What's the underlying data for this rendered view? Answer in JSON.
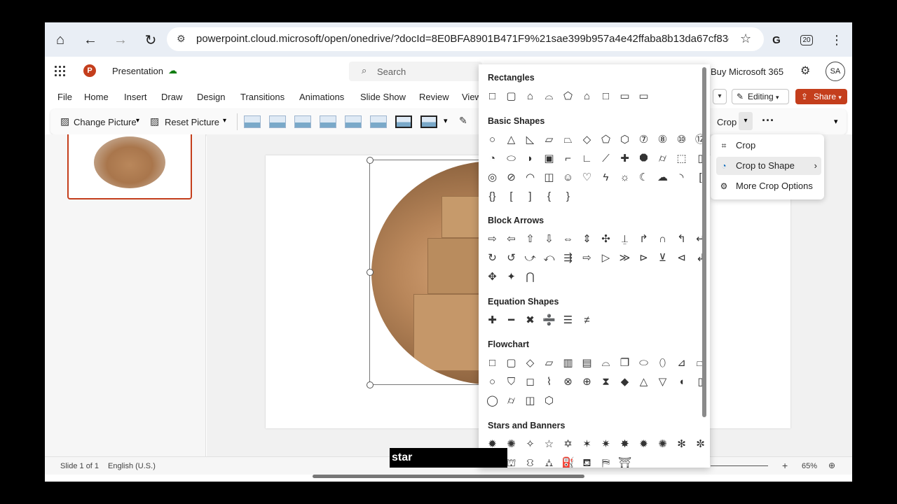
{
  "browser": {
    "url": "powerpoint.cloud.microsoft/open/onedrive/?docId=8E0BFA8901B471F9%21sae399b957a4e42ffaba8b13da67cf83d&c",
    "extension_count": "20"
  },
  "header": {
    "app_title": "Presentation",
    "search_placeholder": "Search",
    "buy_label": "Buy Microsoft 365",
    "avatar_initials": "SA"
  },
  "menu": {
    "items": [
      "File",
      "Home",
      "Insert",
      "Draw",
      "Design",
      "Transitions",
      "Animations",
      "Slide Show",
      "Review",
      "View"
    ],
    "editing_label": "Editing",
    "share_label": "Share"
  },
  "ribbon": {
    "change_picture": "Change Picture",
    "reset_picture": "Reset Picture",
    "crop_label": "Crop",
    "more_label": "···"
  },
  "crop_menu": {
    "items": [
      {
        "label": "Crop",
        "icon": "crop-icon"
      },
      {
        "label": "Crop to Shape",
        "icon": "shape-icon"
      },
      {
        "label": "More Crop Options",
        "icon": "gear-icon"
      }
    ]
  },
  "gallery": {
    "sections": [
      {
        "title": "Rectangles",
        "rows": [
          [
            "□",
            "▢",
            "⌂",
            "⌓",
            "⬠",
            "⌂",
            "□",
            "▭",
            "▭"
          ]
        ]
      },
      {
        "title": "Basic Shapes",
        "rows": [
          [
            "○",
            "△",
            "◺",
            "▱",
            "⏢",
            "◇",
            "⬠",
            "⬡",
            "⑦",
            "⑧",
            "⑩",
            "⑫"
          ],
          [
            "◔",
            "⬭",
            "◗",
            "▣",
            "⌐",
            "∟",
            "⟋",
            "✚",
            "⯃",
            "⌭",
            "⬚",
            "▯"
          ],
          [
            "◎",
            "⊘",
            "◠",
            "◫",
            "☺",
            "♡",
            "ϟ",
            "☼",
            "☾",
            "☁",
            "◝",
            "["
          ],
          [
            "{}",
            "[",
            "]",
            "{",
            "}"
          ]
        ]
      },
      {
        "title": "Block Arrows",
        "rows": [
          [
            "⇨",
            "⇦",
            "⇧",
            "⇩",
            "⇔",
            "⇕",
            "✣",
            "⍊",
            "↱",
            "∩",
            "↰",
            "↵"
          ],
          [
            "↻",
            "↺",
            "⤻",
            "⤺",
            "⇶",
            "⇨",
            "▷",
            "≫",
            "⊳",
            "⊻",
            "⊲",
            "↲"
          ],
          [
            "✥",
            "✦",
            "⋂"
          ]
        ]
      },
      {
        "title": "Equation Shapes",
        "rows": [
          [
            "✚",
            "━",
            "✖",
            "➗",
            "☰",
            "≠"
          ]
        ]
      },
      {
        "title": "Flowchart",
        "rows": [
          [
            "□",
            "▢",
            "◇",
            "▱",
            "▥",
            "▤",
            "⌓",
            "❐",
            "⬭",
            "⬯",
            "⊿",
            "⏢"
          ],
          [
            "○",
            "⛉",
            "◻",
            "⌇",
            "⊗",
            "⊕",
            "⧗",
            "◆",
            "△",
            "▽",
            "◖",
            "▯"
          ],
          [
            "◯",
            "⌭",
            "◫",
            "⬡"
          ]
        ]
      },
      {
        "title": "Stars and Banners",
        "rows": [
          [
            "✹",
            "✺",
            "✧",
            "☆",
            "✡",
            "✶",
            "✷",
            "✸",
            "✹",
            "✺",
            "✻",
            "✼"
          ],
          [
            "⛬",
            "⛫",
            "⛻",
            "⛼",
            "⛽",
            "⛾",
            "⛿",
            "⛩"
          ]
        ]
      }
    ]
  },
  "status": {
    "slide_info": "Slide 1 of 1",
    "language": "English (U.S.)",
    "zoom": "65%"
  },
  "caption": "star"
}
